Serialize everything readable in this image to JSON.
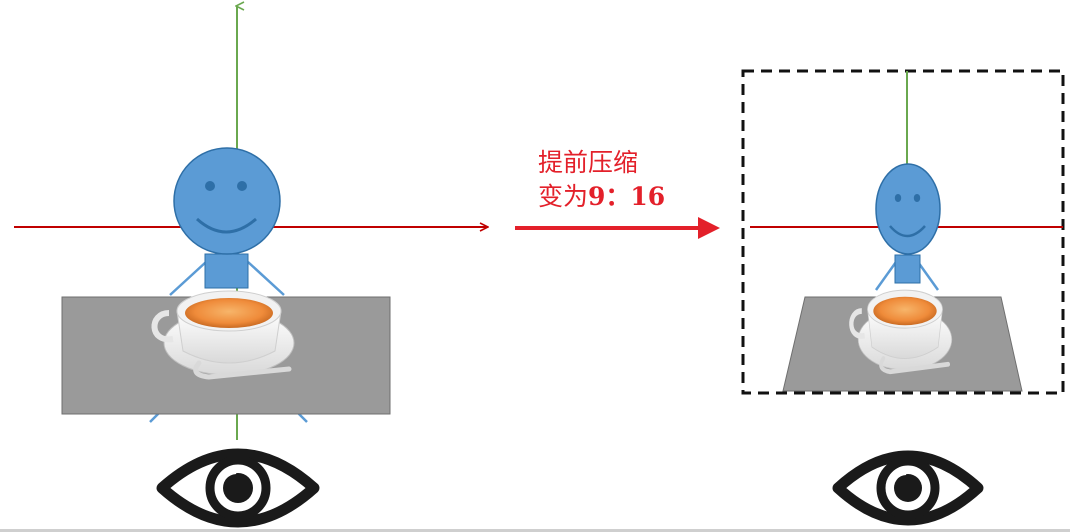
{
  "caption": {
    "line1": "提前压缩",
    "line2_prefix": "变为",
    "line2_ratio": "9：16"
  },
  "colors": {
    "vertical_axis": "#6aa84f",
    "horizontal_axis": "#c00000",
    "arrow": "#e3202a",
    "figure_fill": "#5b9bd5",
    "figure_stroke": "#2e6fa7",
    "table_fill": "#9a9a9a",
    "frame_stroke": "#111111"
  },
  "icons": [
    "eye-icon",
    "teacup-icon",
    "smiley-person-icon"
  ]
}
